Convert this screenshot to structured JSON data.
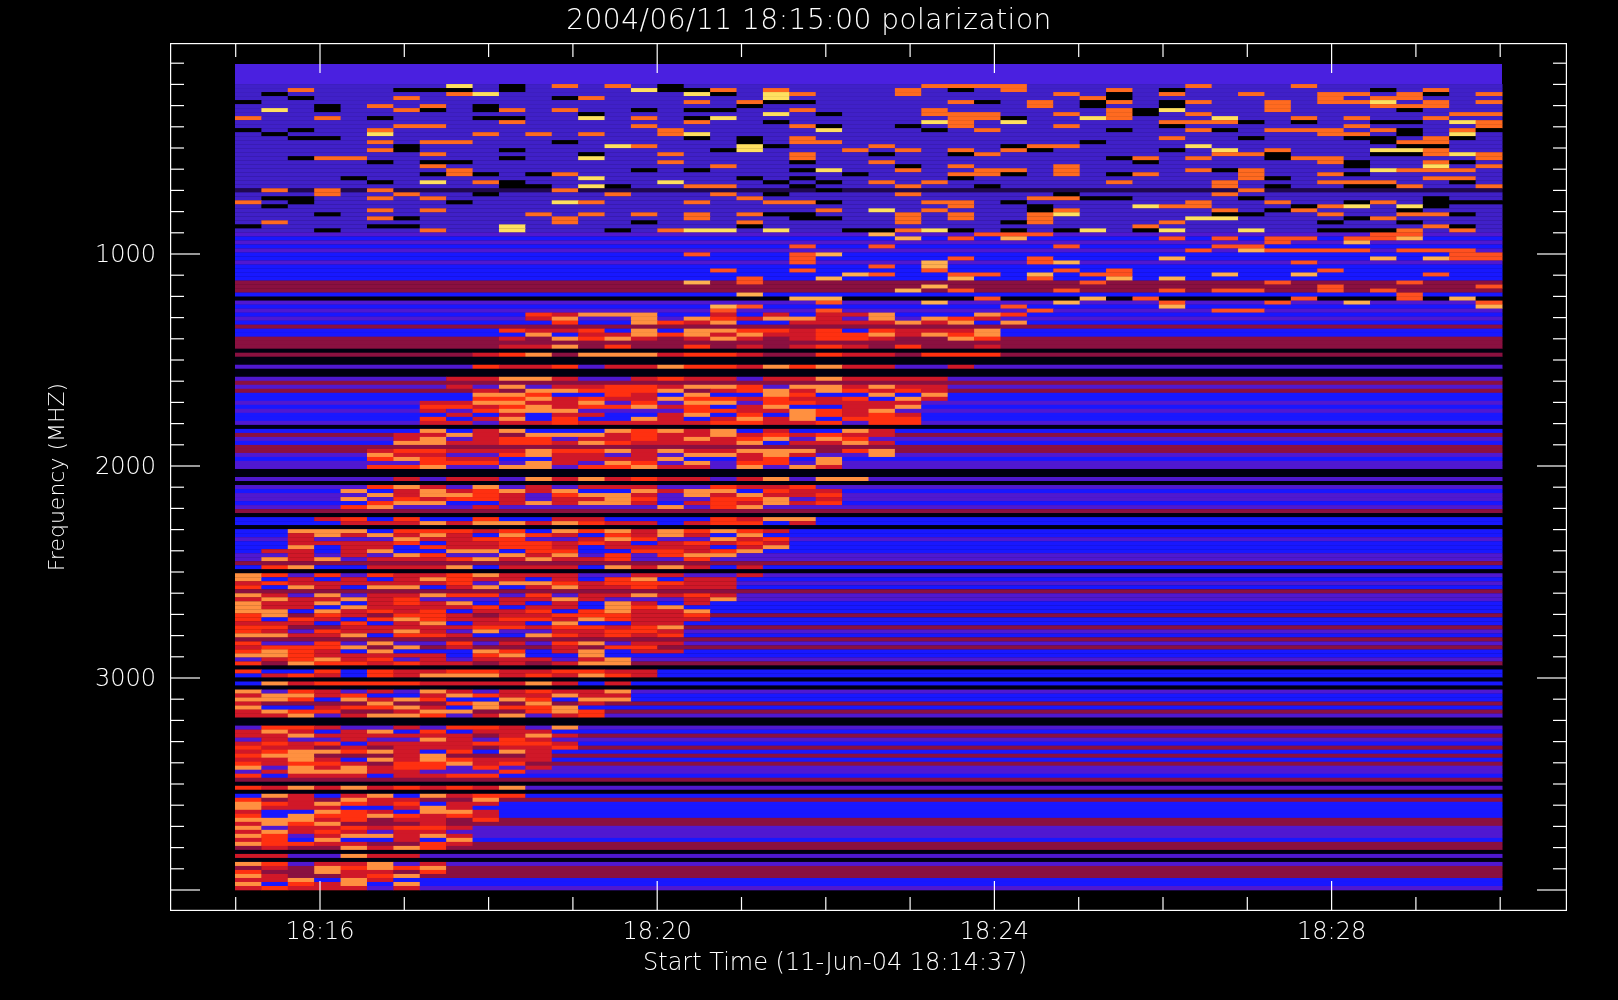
{
  "title": "2004/06/11 18:15:00 polarization",
  "y_axis": {
    "label": "Frequency (MHZ)",
    "ticks": [
      "1000",
      "2000",
      "3000"
    ]
  },
  "x_axis": {
    "label": "Start Time (11-Jun-04 18:14:37)",
    "ticks": [
      "18:16",
      "18:20",
      "18:24",
      "18:28"
    ]
  }
}
